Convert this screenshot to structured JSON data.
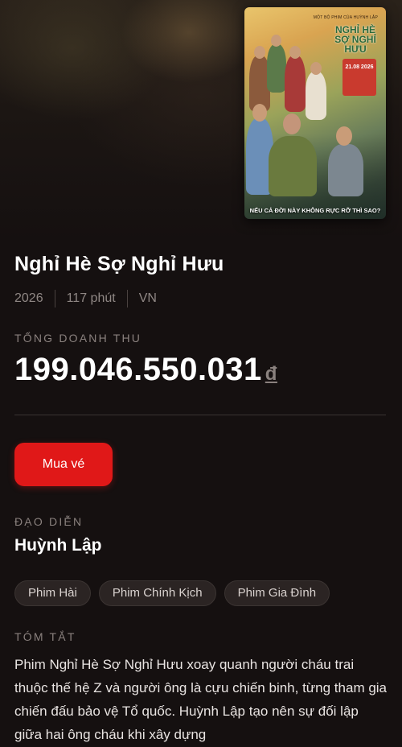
{
  "movie": {
    "title": "Nghỉ Hè Sợ Nghỉ Hưu",
    "year": "2026",
    "duration": "117 phút",
    "country": "VN"
  },
  "poster": {
    "tagline_top": "MỘT BỘ PHIM CỦA HUỲNH LẬP",
    "poster_title": "NGHỈ HÈ SỢ NGHỈ HƯU",
    "release_date": "21.08 2026",
    "slogan": "NẾU CẢ ĐỜI NÀY KHÔNG RỰC RỠ THÌ SAO?"
  },
  "revenue": {
    "label": "TỔNG DOANH THU",
    "amount": "199.046.550.031",
    "currency": "đ"
  },
  "actions": {
    "buy_label": "Mua vé"
  },
  "director": {
    "label": "ĐẠO DIỄN",
    "name": "Huỳnh Lập"
  },
  "genres": [
    "Phim Hài",
    "Phim Chính Kịch",
    "Phim Gia Đình"
  ],
  "synopsis": {
    "label": "TÓM TẮT",
    "text": "Phim Nghỉ Hè Sợ Nghỉ Hưu xoay quanh người cháu trai thuộc thế hệ Z và người ông là cựu chiến binh, từng tham gia chiến đấu bảo vệ Tổ quốc. Huỳnh Lập tạo nên sự đối lập giữa hai ông cháu khi xây dựng"
  },
  "colors": {
    "background": "#151010",
    "accent": "#e01818",
    "muted_text": "#8a817e"
  }
}
